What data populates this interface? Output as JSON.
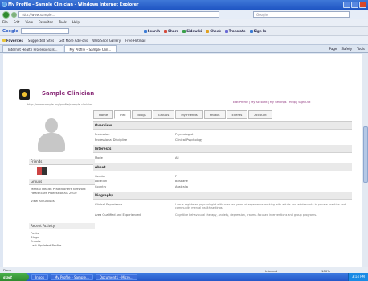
{
  "window": {
    "title": "My Profile – Sample Clinician – Windows Internet Explorer"
  },
  "address": {
    "url": "http://www.sample...",
    "search_placeholder": "Google"
  },
  "menu": [
    "File",
    "Edit",
    "View",
    "Favorites",
    "Tools",
    "Help"
  ],
  "google_toolbar": {
    "logo": "Google",
    "tools": [
      "Search",
      "Share",
      "Sidewiki",
      "Check",
      "Translate",
      "Sign In"
    ]
  },
  "favorites": {
    "label": "Favorites",
    "items": [
      "Suggested Sites",
      "Get More Add-ons",
      "Web Slice Gallery",
      "Free Hotmail"
    ]
  },
  "tabs": [
    {
      "label": "Internet Health Professionals..."
    },
    {
      "label": "My Profile – Sample Clin..."
    }
  ],
  "tab_tools": [
    "Page",
    "Safety",
    "Tools"
  ],
  "profile": {
    "name": "Sample Clinician",
    "url_line": "http://www.sample.org/profile/sample-clinician",
    "links": "Edit Profile | My Account | My Settings | Help | Sign Out"
  },
  "sidebar": {
    "friends_header": "Friends",
    "groups_header": "Groups",
    "groups_items": [
      "Mental Health Practitioners Network",
      "Healthcare Professionals 2010"
    ],
    "more_groups": "View All Groups",
    "recent_header": "Recent Activity",
    "recent_items": [
      "Posts",
      "Blogs",
      "Events",
      "Last Updated Profile"
    ]
  },
  "profile_tabs": [
    "Home",
    "Info",
    "Blogs",
    "Groups",
    "My Friends",
    "Photos",
    "Events",
    "Account"
  ],
  "content": {
    "sections": [
      {
        "title": "Overview",
        "rows": [
          [
            "Profession",
            "Psychologist"
          ],
          [
            "Professional Discipline",
            "Clinical Psychology"
          ]
        ]
      },
      {
        "title": "Interests",
        "rows": [
          [
            "Mode",
            "All"
          ]
        ]
      },
      {
        "title": "About",
        "rows": [
          [
            "Gender",
            "F"
          ],
          [
            "Location",
            "Brisbane"
          ],
          [
            "Country",
            "Australia"
          ]
        ]
      },
      {
        "title": "Biography",
        "rows": [
          [
            "Clinical Experience",
            "I am a registered psychologist with over ten years of experience working with adults and adolescents in private practice and community mental health settings."
          ],
          [
            "Area Qualified and Experienced",
            "Cognitive behavioural therapy, anxiety, depression, trauma-focused interventions and group programs."
          ]
        ]
      }
    ]
  },
  "status": {
    "text": "Done",
    "zone": "Internet",
    "zoom": "100%"
  },
  "taskbar": {
    "start": "start",
    "items": [
      "Inbox",
      "My Profile – Sample...",
      "Document1 - Micro..."
    ],
    "clock": "3:14 PM"
  }
}
